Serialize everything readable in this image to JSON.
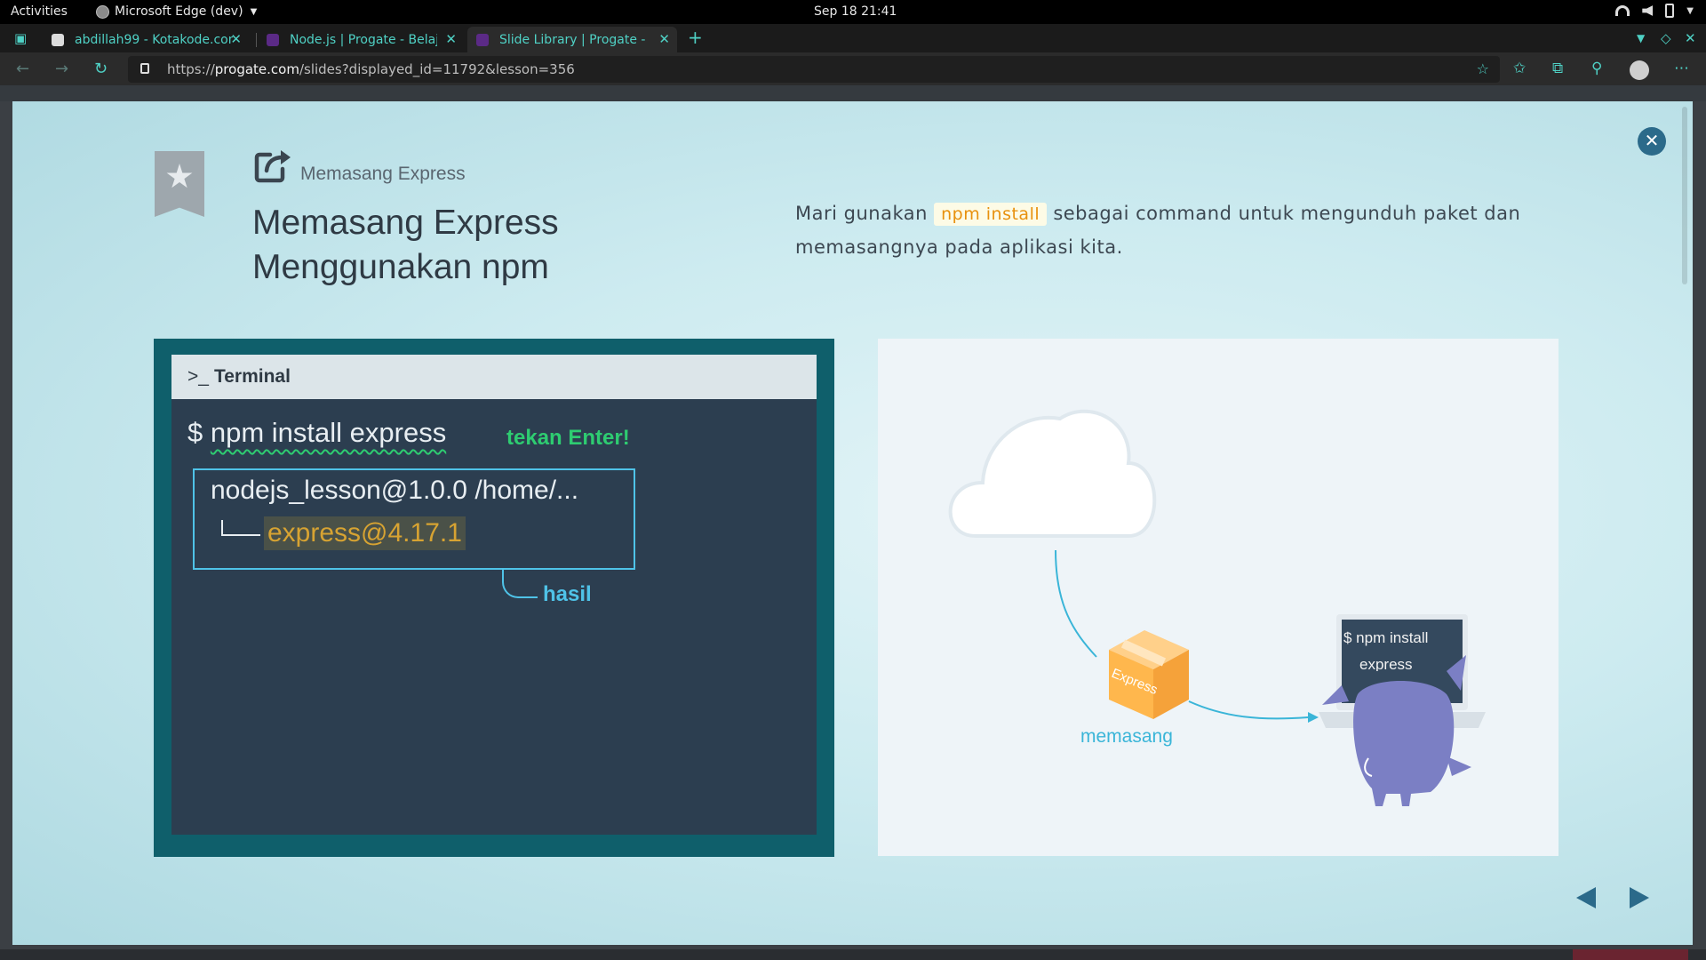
{
  "system_bar": {
    "activities": "Activities",
    "app_name": "Microsoft Edge (dev)",
    "clock": "Sep 18  21:41"
  },
  "browser": {
    "tabs": [
      {
        "title": "abdillah99 - Kotakode.com",
        "active": false
      },
      {
        "title": "Node.js | Progate - Belajar",
        "active": false
      },
      {
        "title": "Slide Library | Progate - Belajar",
        "active": true
      }
    ],
    "url_prefix": "https://",
    "url_domain": "progate.com",
    "url_path": "/slides?displayed_id=11792&lesson=356"
  },
  "slide": {
    "breadcrumb": "Memasang Express",
    "title_line1": "Memasang Express",
    "title_line2": "Menggunakan npm",
    "desc_before": "Mari gunakan ",
    "desc_code": "npm install",
    "desc_after": " sebagai command untuk mengunduh paket dan memasangnya pada aplikasi kita.",
    "terminal": {
      "prompt_icon": ">_",
      "title": "Terminal",
      "dollar": "$ ",
      "command": "npm install express",
      "hint": "tekan Enter!",
      "result_line1": "nodejs_lesson@1.0.0 /home/...",
      "result_line2": "express@4.17.1",
      "result_label": "hasil"
    },
    "illustration": {
      "package_label": "Express",
      "arrow_label": "memasang",
      "laptop_line1": "$ npm install",
      "laptop_line2": "express"
    }
  },
  "colors": {
    "accent": "#4fd1c5",
    "modal_close": "#2b6a8a",
    "terminal_frame": "#0f5f6b",
    "terminal_bg": "#2c3e50",
    "hint_green": "#2ecc71",
    "result_blue": "#4fc3e8",
    "package_orange": "#ffb74d",
    "character_purple": "#7b7fc4"
  }
}
